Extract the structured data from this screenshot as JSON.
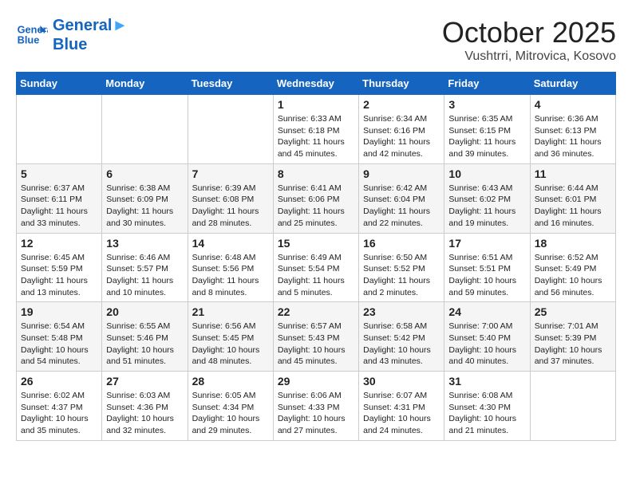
{
  "header": {
    "logo_line1": "General",
    "logo_line2": "Blue",
    "month": "October 2025",
    "location": "Vushtrri, Mitrovica, Kosovo"
  },
  "weekdays": [
    "Sunday",
    "Monday",
    "Tuesday",
    "Wednesday",
    "Thursday",
    "Friday",
    "Saturday"
  ],
  "weeks": [
    [
      {
        "day": "",
        "info": ""
      },
      {
        "day": "",
        "info": ""
      },
      {
        "day": "",
        "info": ""
      },
      {
        "day": "1",
        "info": "Sunrise: 6:33 AM\nSunset: 6:18 PM\nDaylight: 11 hours and 45 minutes."
      },
      {
        "day": "2",
        "info": "Sunrise: 6:34 AM\nSunset: 6:16 PM\nDaylight: 11 hours and 42 minutes."
      },
      {
        "day": "3",
        "info": "Sunrise: 6:35 AM\nSunset: 6:15 PM\nDaylight: 11 hours and 39 minutes."
      },
      {
        "day": "4",
        "info": "Sunrise: 6:36 AM\nSunset: 6:13 PM\nDaylight: 11 hours and 36 minutes."
      }
    ],
    [
      {
        "day": "5",
        "info": "Sunrise: 6:37 AM\nSunset: 6:11 PM\nDaylight: 11 hours and 33 minutes."
      },
      {
        "day": "6",
        "info": "Sunrise: 6:38 AM\nSunset: 6:09 PM\nDaylight: 11 hours and 30 minutes."
      },
      {
        "day": "7",
        "info": "Sunrise: 6:39 AM\nSunset: 6:08 PM\nDaylight: 11 hours and 28 minutes."
      },
      {
        "day": "8",
        "info": "Sunrise: 6:41 AM\nSunset: 6:06 PM\nDaylight: 11 hours and 25 minutes."
      },
      {
        "day": "9",
        "info": "Sunrise: 6:42 AM\nSunset: 6:04 PM\nDaylight: 11 hours and 22 minutes."
      },
      {
        "day": "10",
        "info": "Sunrise: 6:43 AM\nSunset: 6:02 PM\nDaylight: 11 hours and 19 minutes."
      },
      {
        "day": "11",
        "info": "Sunrise: 6:44 AM\nSunset: 6:01 PM\nDaylight: 11 hours and 16 minutes."
      }
    ],
    [
      {
        "day": "12",
        "info": "Sunrise: 6:45 AM\nSunset: 5:59 PM\nDaylight: 11 hours and 13 minutes."
      },
      {
        "day": "13",
        "info": "Sunrise: 6:46 AM\nSunset: 5:57 PM\nDaylight: 11 hours and 10 minutes."
      },
      {
        "day": "14",
        "info": "Sunrise: 6:48 AM\nSunset: 5:56 PM\nDaylight: 11 hours and 8 minutes."
      },
      {
        "day": "15",
        "info": "Sunrise: 6:49 AM\nSunset: 5:54 PM\nDaylight: 11 hours and 5 minutes."
      },
      {
        "day": "16",
        "info": "Sunrise: 6:50 AM\nSunset: 5:52 PM\nDaylight: 11 hours and 2 minutes."
      },
      {
        "day": "17",
        "info": "Sunrise: 6:51 AM\nSunset: 5:51 PM\nDaylight: 10 hours and 59 minutes."
      },
      {
        "day": "18",
        "info": "Sunrise: 6:52 AM\nSunset: 5:49 PM\nDaylight: 10 hours and 56 minutes."
      }
    ],
    [
      {
        "day": "19",
        "info": "Sunrise: 6:54 AM\nSunset: 5:48 PM\nDaylight: 10 hours and 54 minutes."
      },
      {
        "day": "20",
        "info": "Sunrise: 6:55 AM\nSunset: 5:46 PM\nDaylight: 10 hours and 51 minutes."
      },
      {
        "day": "21",
        "info": "Sunrise: 6:56 AM\nSunset: 5:45 PM\nDaylight: 10 hours and 48 minutes."
      },
      {
        "day": "22",
        "info": "Sunrise: 6:57 AM\nSunset: 5:43 PM\nDaylight: 10 hours and 45 minutes."
      },
      {
        "day": "23",
        "info": "Sunrise: 6:58 AM\nSunset: 5:42 PM\nDaylight: 10 hours and 43 minutes."
      },
      {
        "day": "24",
        "info": "Sunrise: 7:00 AM\nSunset: 5:40 PM\nDaylight: 10 hours and 40 minutes."
      },
      {
        "day": "25",
        "info": "Sunrise: 7:01 AM\nSunset: 5:39 PM\nDaylight: 10 hours and 37 minutes."
      }
    ],
    [
      {
        "day": "26",
        "info": "Sunrise: 6:02 AM\nSunset: 4:37 PM\nDaylight: 10 hours and 35 minutes."
      },
      {
        "day": "27",
        "info": "Sunrise: 6:03 AM\nSunset: 4:36 PM\nDaylight: 10 hours and 32 minutes."
      },
      {
        "day": "28",
        "info": "Sunrise: 6:05 AM\nSunset: 4:34 PM\nDaylight: 10 hours and 29 minutes."
      },
      {
        "day": "29",
        "info": "Sunrise: 6:06 AM\nSunset: 4:33 PM\nDaylight: 10 hours and 27 minutes."
      },
      {
        "day": "30",
        "info": "Sunrise: 6:07 AM\nSunset: 4:31 PM\nDaylight: 10 hours and 24 minutes."
      },
      {
        "day": "31",
        "info": "Sunrise: 6:08 AM\nSunset: 4:30 PM\nDaylight: 10 hours and 21 minutes."
      },
      {
        "day": "",
        "info": ""
      }
    ]
  ]
}
